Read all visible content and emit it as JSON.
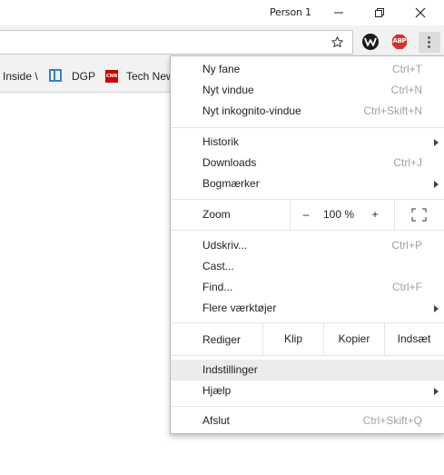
{
  "titlebar": {
    "profile": "Person 1",
    "minimize_icon": "minimize-icon",
    "maximize_icon": "restore-icon",
    "close_icon": "close-icon"
  },
  "toolbar": {
    "omnibox_value": "",
    "star_icon": "star-icon",
    "extensions": [
      {
        "name": "va-extension-icon",
        "color": "#1b1b1b"
      },
      {
        "name": "abp-extension-icon",
        "label": "ABP",
        "color": "#d9302c"
      }
    ],
    "menu_icon": "kebab-menu-icon"
  },
  "bookmarks": [
    {
      "label": "Inside \\"
    },
    {
      "label": "DGP",
      "icon": "dgp-favicon"
    },
    {
      "label": "Tech New",
      "icon": "cnn-favicon",
      "icon_text": "CNN"
    }
  ],
  "menu": {
    "new_tab": {
      "label": "Ny fane",
      "shortcut": "Ctrl+T"
    },
    "new_window": {
      "label": "Nyt vindue",
      "shortcut": "Ctrl+N"
    },
    "incognito": {
      "label": "Nyt inkognito-vindue",
      "shortcut": "Ctrl+Skift+N"
    },
    "history": {
      "label": "Historik"
    },
    "downloads": {
      "label": "Downloads",
      "shortcut": "Ctrl+J"
    },
    "bookmarks": {
      "label": "Bogmærker"
    },
    "zoom": {
      "label": "Zoom",
      "minus": "–",
      "value": "100 %",
      "plus": "+"
    },
    "print": {
      "label": "Udskriv...",
      "shortcut": "Ctrl+P"
    },
    "cast": {
      "label": "Cast..."
    },
    "find": {
      "label": "Find...",
      "shortcut": "Ctrl+F"
    },
    "more_tools": {
      "label": "Flere værktøjer"
    },
    "edit": {
      "label": "Rediger",
      "cut": "Klip",
      "copy": "Kopier",
      "paste": "Indsæt"
    },
    "settings": {
      "label": "Indstillinger"
    },
    "help": {
      "label": "Hjælp"
    },
    "exit": {
      "label": "Afslut",
      "shortcut": "Ctrl+Skift+Q"
    }
  },
  "colors": {
    "toolbar_bg": "#f2f2f2",
    "menu_highlight": "#ececec",
    "shortcut_text": "#a0a0a0"
  }
}
